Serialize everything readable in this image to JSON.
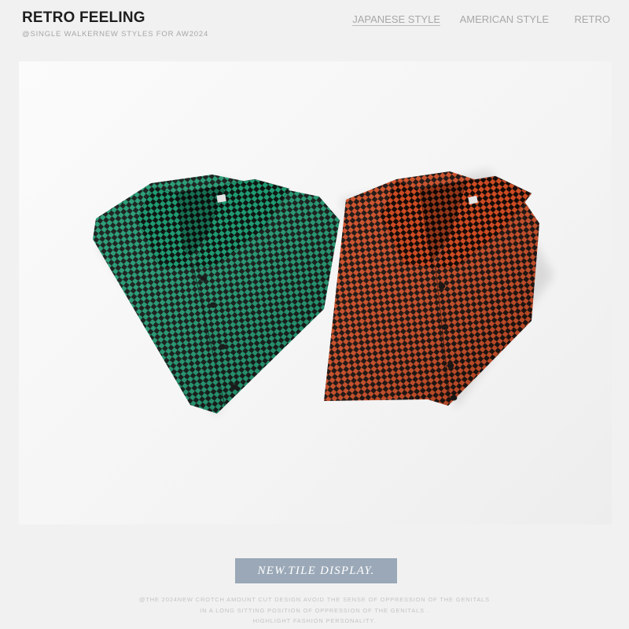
{
  "header": {
    "brand": "RETRO FEELING",
    "tagline": "@SINGLE WALKERNEW STYLES FOR AW2024",
    "nav": [
      "JAPANESE STYLE",
      "AMERICAN STYLE",
      "RETRO"
    ]
  },
  "product_photo": {
    "items": [
      {
        "name": "green-checkered-shirt",
        "check_color": "#1f9a72",
        "dark_color": "#101612"
      },
      {
        "name": "orange-checkered-shirt",
        "check_color": "#cc4a22",
        "dark_color": "#150c09"
      }
    ]
  },
  "display_button": {
    "label": "NEW.TILE DISPLAY."
  },
  "description": [
    "@THE 2024NEW CROTCH AMOUNT CUT DESIGN.AVOID THE SENSE OF OPPRESSION OF THE GENITALS",
    "IN A LONG SITTING POSITION OF OPPRESSION OF THE GENITALS .",
    "HIGHLIGHT FASHION PERSONALITY."
  ]
}
